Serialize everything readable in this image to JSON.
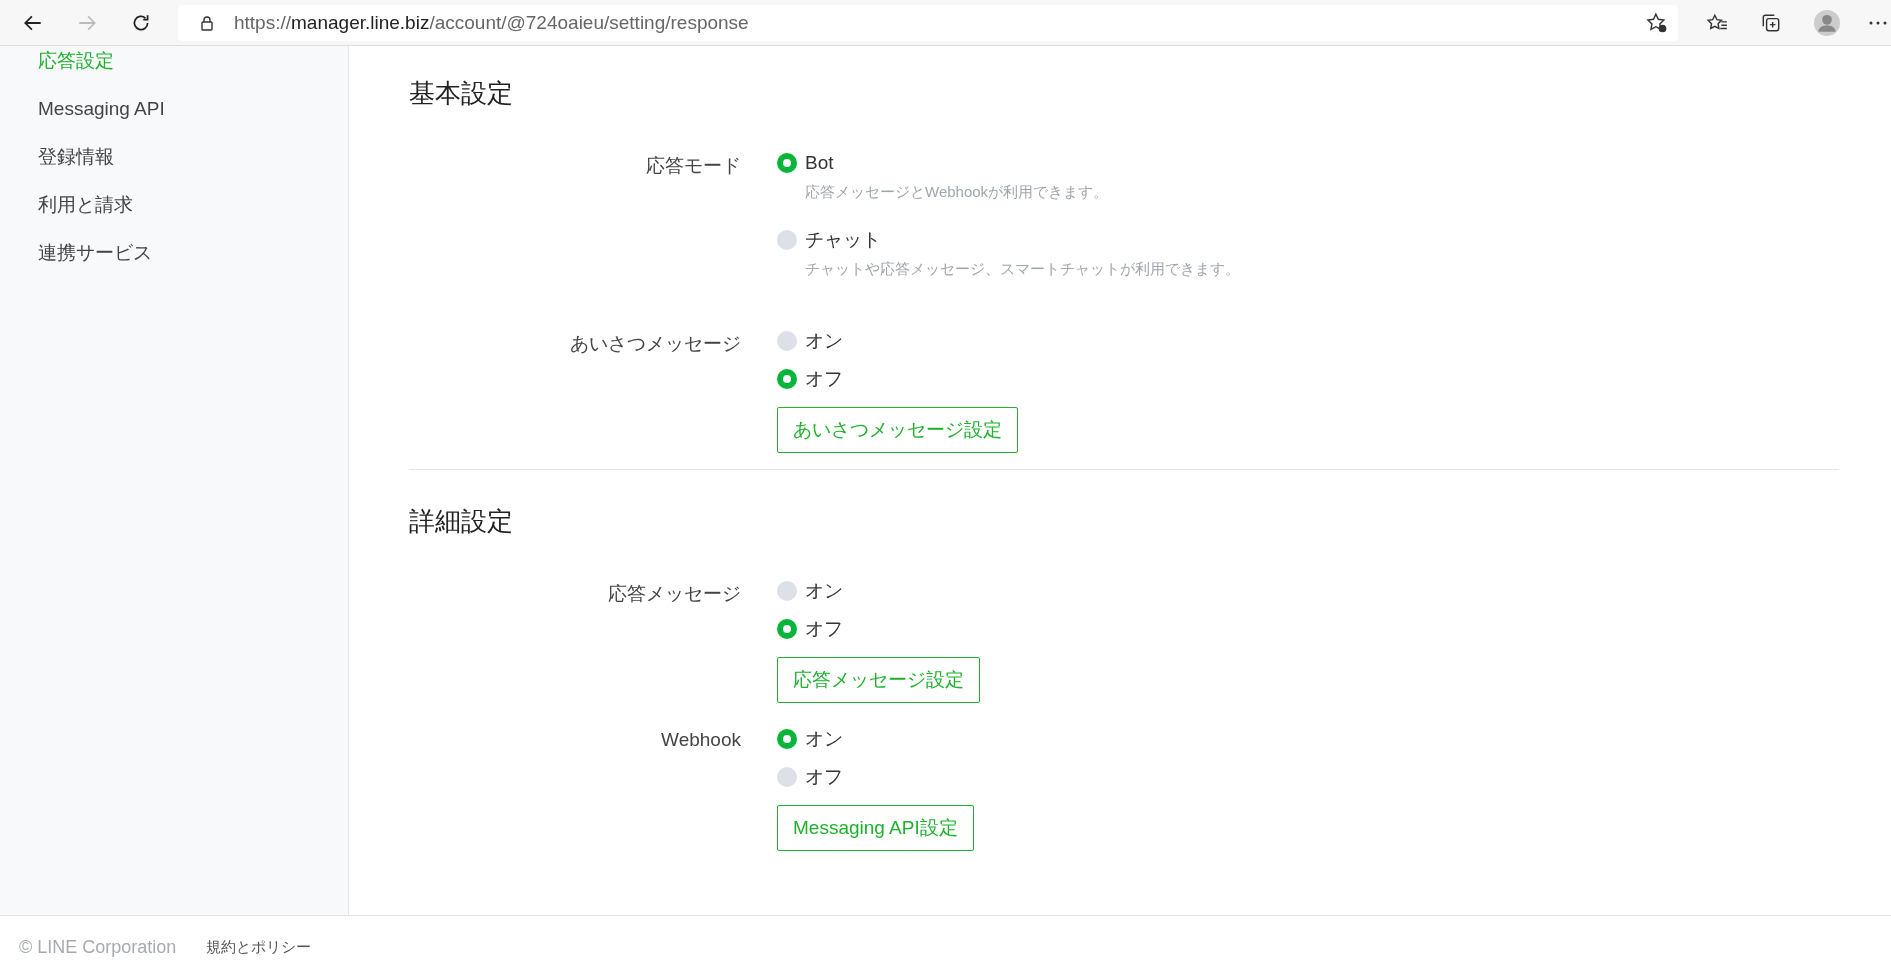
{
  "browser": {
    "url": {
      "scheme": "https://",
      "host": "manager.line.biz",
      "path": "/account/@724oaieu/setting/response"
    }
  },
  "sidebar": {
    "items": [
      {
        "label": "応答設定",
        "selected": true
      },
      {
        "label": "Messaging API",
        "selected": false
      },
      {
        "label": "登録情報",
        "selected": false
      },
      {
        "label": "利用と請求",
        "selected": false
      },
      {
        "label": "連携サービス",
        "selected": false
      }
    ]
  },
  "sections": [
    {
      "title": "基本設定",
      "settings": [
        {
          "label": "応答モード",
          "options": [
            {
              "label": "Bot",
              "description": "応答メッセージとWebhookが利用できます。",
              "selected": true
            },
            {
              "label": "チャット",
              "description": "チャットや応答メッセージ、スマートチャットが利用できます。",
              "selected": false
            }
          ]
        },
        {
          "label": "あいさつメッセージ",
          "options": [
            {
              "label": "オン",
              "selected": false
            },
            {
              "label": "オフ",
              "selected": true
            }
          ],
          "button": "あいさつメッセージ設定"
        }
      ]
    },
    {
      "title": "詳細設定",
      "settings": [
        {
          "label": "応答メッセージ",
          "options": [
            {
              "label": "オン",
              "selected": false
            },
            {
              "label": "オフ",
              "selected": true
            }
          ],
          "button": "応答メッセージ設定"
        },
        {
          "label": "Webhook",
          "options": [
            {
              "label": "オン",
              "selected": true
            },
            {
              "label": "オフ",
              "selected": false
            }
          ],
          "button": "Messaging API設定"
        }
      ]
    }
  ],
  "footer": {
    "copyright": "© LINE Corporation",
    "link": "規約とポリシー"
  }
}
